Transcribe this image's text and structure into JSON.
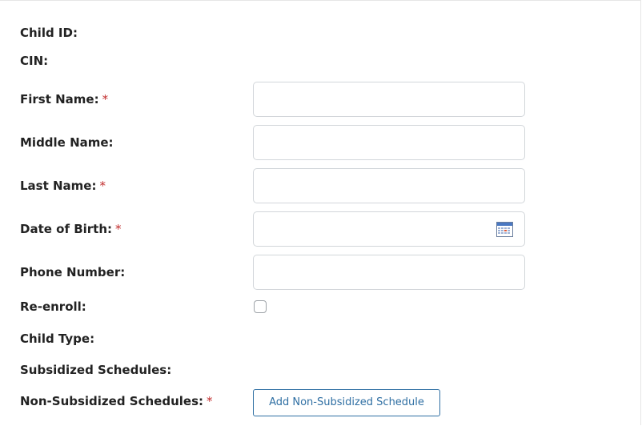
{
  "form": {
    "child_id_label": "Child ID:",
    "cin_label": "CIN:",
    "first_name_label": "First Name:",
    "middle_name_label": "Middle Name:",
    "last_name_label": "Last Name:",
    "dob_label": "Date of Birth:",
    "phone_label": "Phone Number:",
    "reenroll_label": "Re-enroll:",
    "child_type_label": "Child Type:",
    "subsidized_label": "Subsidized Schedules:",
    "non_subsidized_label": "Non-Subsidized Schedules:",
    "required_marker": "*",
    "first_name_value": "",
    "middle_name_value": "",
    "last_name_value": "",
    "dob_value": "",
    "phone_value": "",
    "reenroll_checked": false,
    "add_non_subsidized_button": "Add Non-Subsidized Schedule",
    "calendar_icon": "calendar-icon"
  },
  "colors": {
    "required": "#c12c2c",
    "button_accent": "#2f6fa3",
    "input_border": "#d2d6da"
  }
}
